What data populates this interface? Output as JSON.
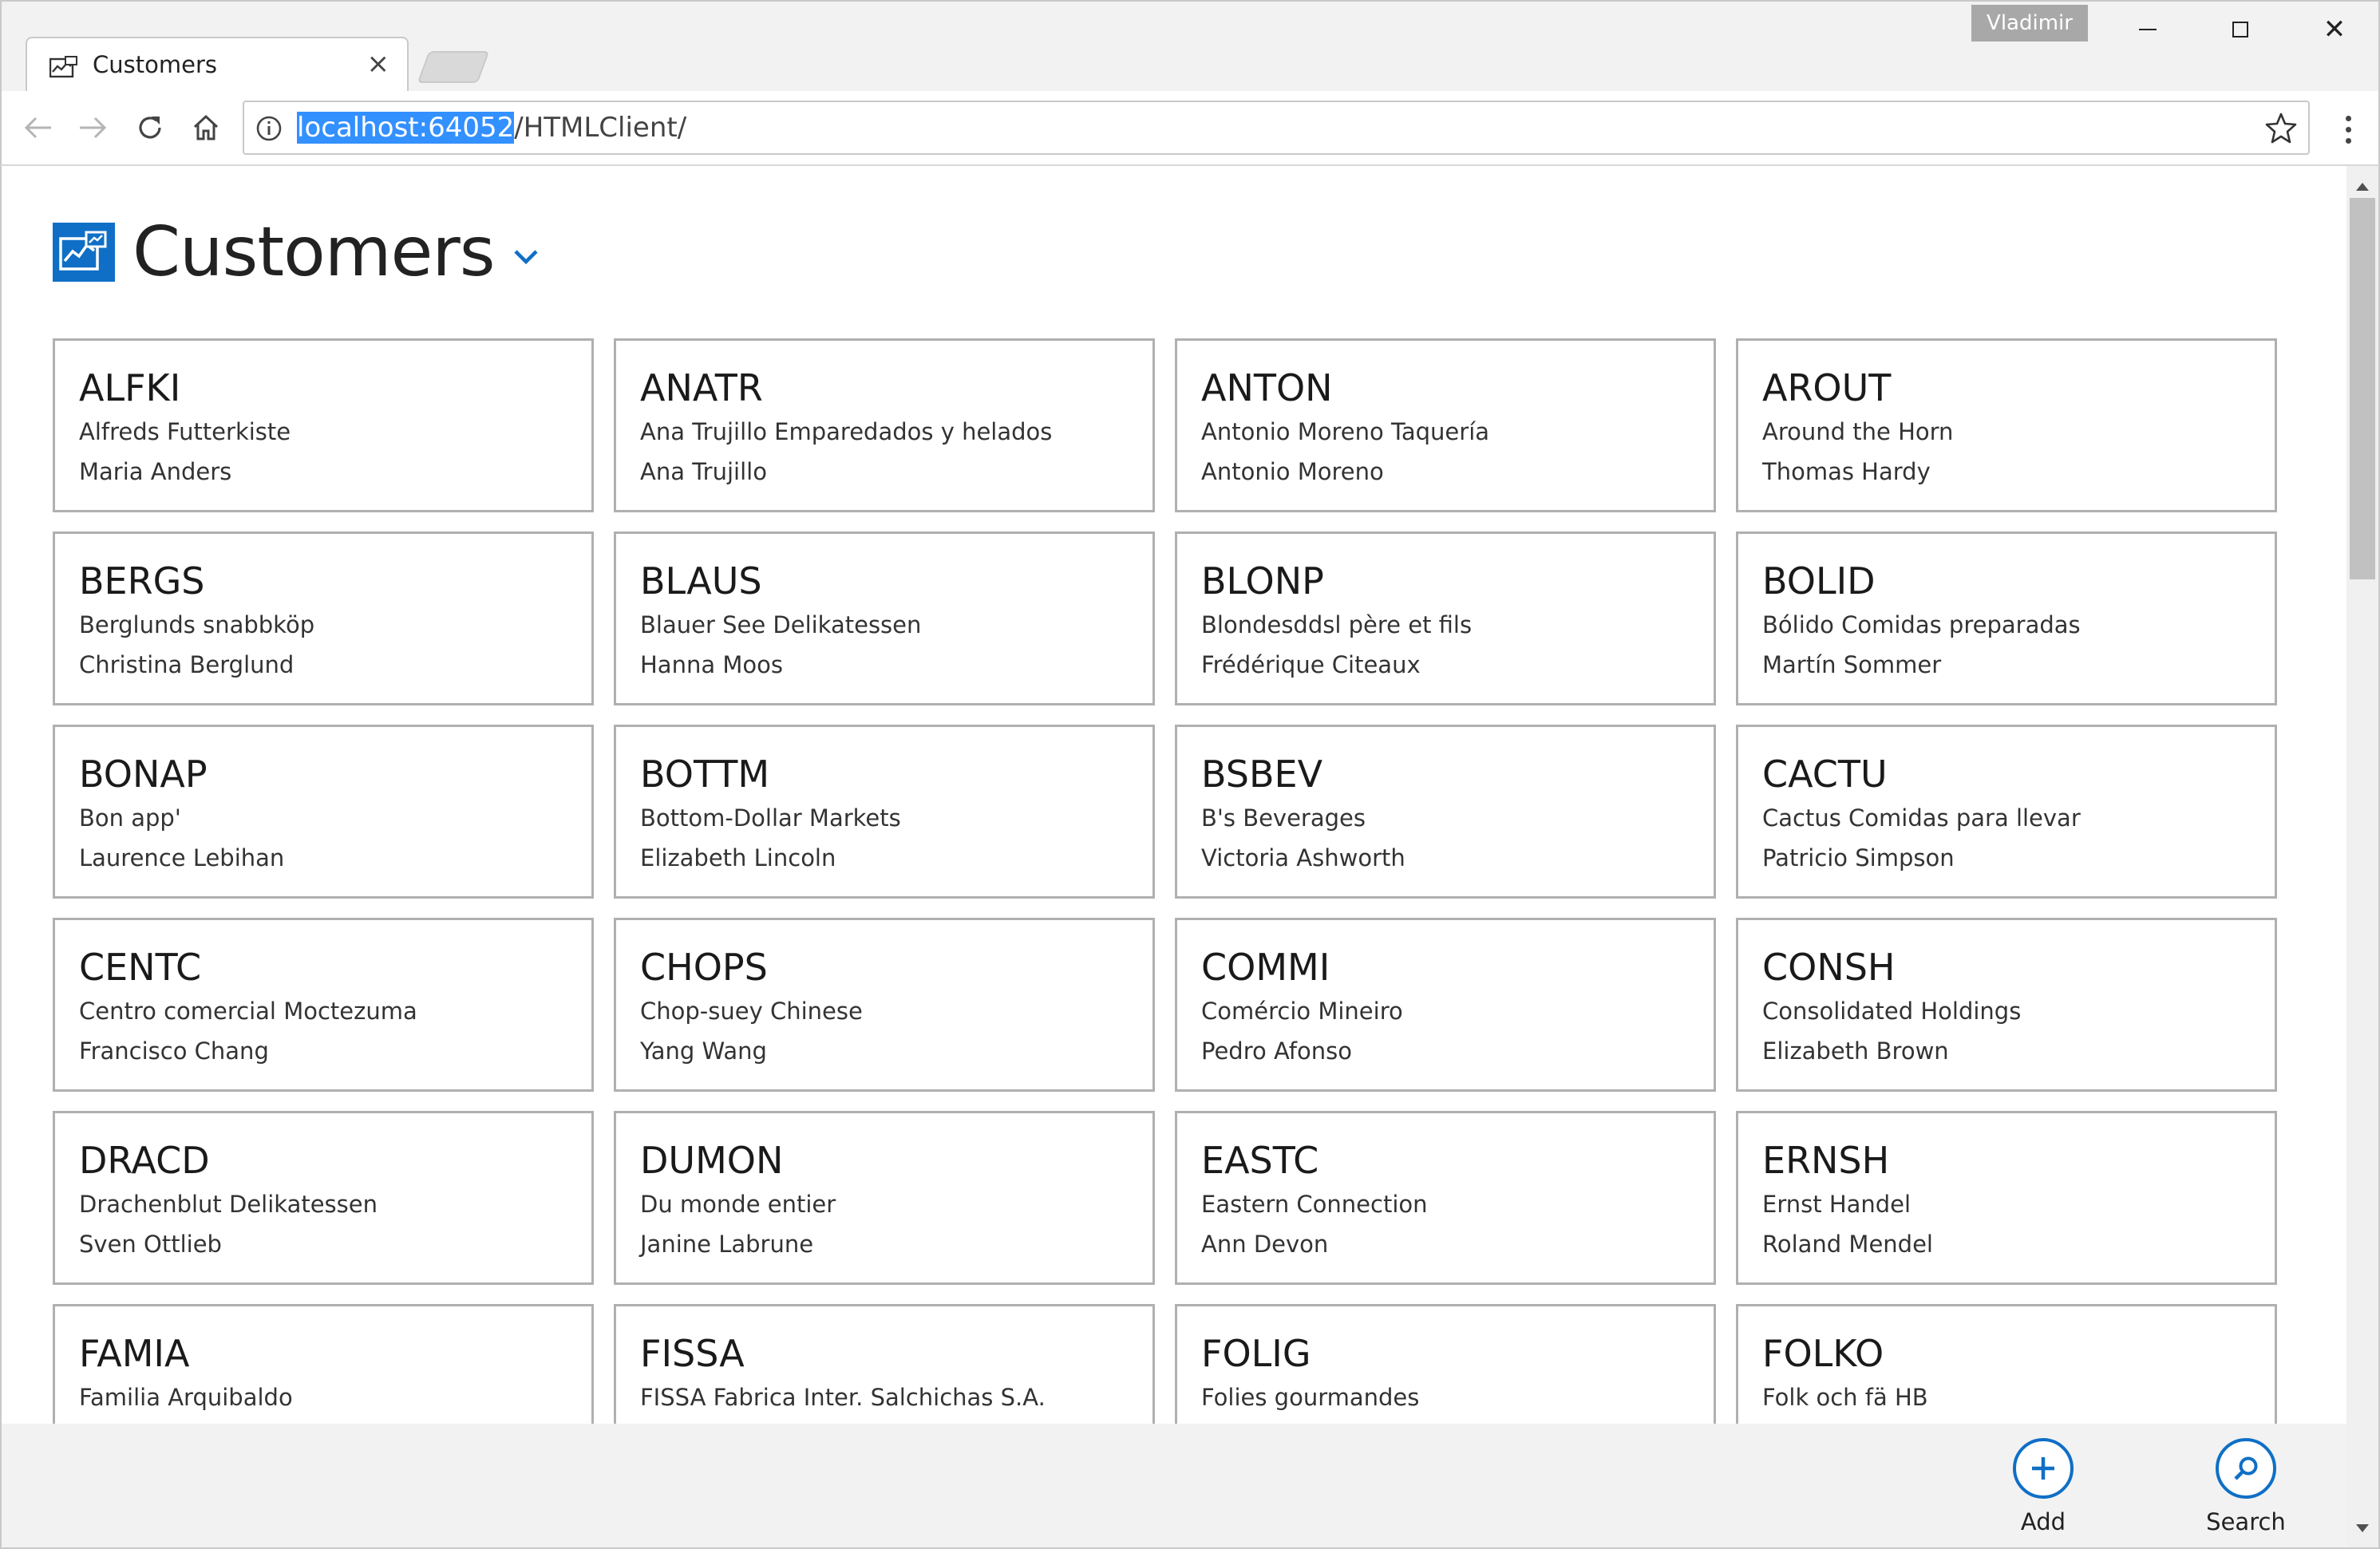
{
  "browser": {
    "tab_title": "Customers",
    "tab_close": "×",
    "user_name": "Vladimir",
    "url_host": "localhost:64052",
    "url_path": "/HTMLClient/",
    "close_glyph": "✕"
  },
  "page": {
    "title": "Customers"
  },
  "customers": [
    {
      "id": "ALFKI",
      "company": "Alfreds Futterkiste",
      "contact": "Maria Anders"
    },
    {
      "id": "ANATR",
      "company": "Ana Trujillo Emparedados y helados",
      "contact": "Ana Trujillo"
    },
    {
      "id": "ANTON",
      "company": "Antonio Moreno Taquería",
      "contact": "Antonio Moreno"
    },
    {
      "id": "AROUT",
      "company": "Around the Horn",
      "contact": "Thomas Hardy"
    },
    {
      "id": "BERGS",
      "company": "Berglunds snabbköp",
      "contact": "Christina Berglund"
    },
    {
      "id": "BLAUS",
      "company": "Blauer See Delikatessen",
      "contact": "Hanna Moos"
    },
    {
      "id": "BLONP",
      "company": "Blondesddsl père et fils",
      "contact": "Frédérique Citeaux"
    },
    {
      "id": "BOLID",
      "company": "Bólido Comidas preparadas",
      "contact": "Martín Sommer"
    },
    {
      "id": "BONAP",
      "company": "Bon app'",
      "contact": "Laurence Lebihan"
    },
    {
      "id": "BOTTM",
      "company": "Bottom-Dollar Markets",
      "contact": "Elizabeth Lincoln"
    },
    {
      "id": "BSBEV",
      "company": "B's Beverages",
      "contact": "Victoria Ashworth"
    },
    {
      "id": "CACTU",
      "company": "Cactus Comidas para llevar",
      "contact": "Patricio Simpson"
    },
    {
      "id": "CENTC",
      "company": "Centro comercial Moctezuma",
      "contact": "Francisco Chang"
    },
    {
      "id": "CHOPS",
      "company": "Chop-suey Chinese",
      "contact": "Yang Wang"
    },
    {
      "id": "COMMI",
      "company": "Comércio Mineiro",
      "contact": "Pedro Afonso"
    },
    {
      "id": "CONSH",
      "company": "Consolidated Holdings",
      "contact": "Elizabeth Brown"
    },
    {
      "id": "DRACD",
      "company": "Drachenblut Delikatessen",
      "contact": "Sven Ottlieb"
    },
    {
      "id": "DUMON",
      "company": "Du monde entier",
      "contact": "Janine Labrune"
    },
    {
      "id": "EASTC",
      "company": "Eastern Connection",
      "contact": "Ann Devon"
    },
    {
      "id": "ERNSH",
      "company": "Ernst Handel",
      "contact": "Roland Mendel"
    },
    {
      "id": "FAMIA",
      "company": "Familia Arquibaldo",
      "contact": ""
    },
    {
      "id": "FISSA",
      "company": "FISSA Fabrica Inter. Salchichas S.A.",
      "contact": ""
    },
    {
      "id": "FOLIG",
      "company": "Folies gourmandes",
      "contact": ""
    },
    {
      "id": "FOLKO",
      "company": "Folk och fä HB",
      "contact": ""
    }
  ],
  "commands": {
    "add_label": "Add",
    "search_label": "Search"
  },
  "colors": {
    "accent": "#0f6fc6",
    "url_selection": "#3390ff",
    "card_border": "#b0b0b0",
    "command_bar": "#f2f2f2"
  }
}
